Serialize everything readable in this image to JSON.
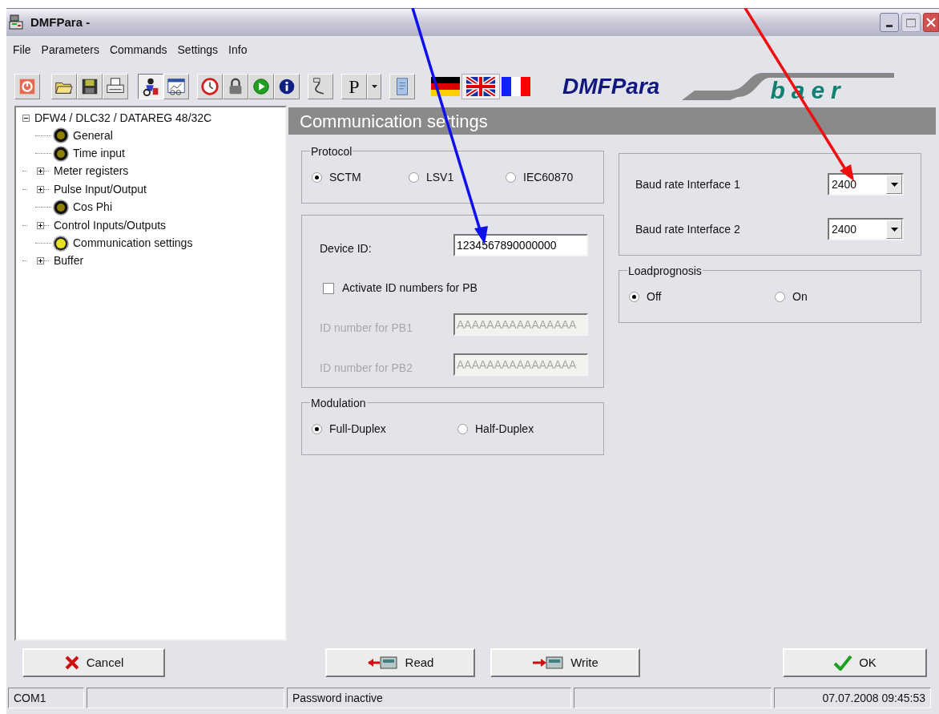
{
  "window": {
    "title": "DMFPara -"
  },
  "menu": [
    "File",
    "Parameters",
    "Commands",
    "Settings",
    "Info"
  ],
  "toolbar": [
    {
      "selected": false
    },
    {
      "selected": false
    },
    {
      "selected": false
    },
    {
      "selected": false
    },
    {
      "selected": true
    },
    {
      "selected": false
    },
    {
      "selected": false
    },
    {
      "selected": false
    },
    {
      "selected": false
    },
    {
      "selected": false
    },
    {
      "selected": false
    },
    {
      "label": "P",
      "selected": false
    },
    {
      "selected": false
    }
  ],
  "languages": [
    {
      "selected": false
    },
    {
      "selected": true
    },
    {
      "selected": false
    }
  ],
  "brand": "DMFPara",
  "logo": "baer",
  "tree": {
    "label": "DFW4 / DLC32 / DATAREG 48/32C",
    "expanded": true,
    "children": [
      {
        "label": "General",
        "kind": "leaf",
        "selected": false
      },
      {
        "label": "Time input",
        "kind": "leaf",
        "selected": false
      },
      {
        "label": "Meter registers",
        "kind": "folder",
        "expanded": false
      },
      {
        "label": "Pulse Input/Output",
        "kind": "folder",
        "expanded": false
      },
      {
        "label": "Cos Phi",
        "kind": "leaf",
        "selected": false
      },
      {
        "label": "Control Inputs/Outputs",
        "kind": "folder",
        "expanded": false
      },
      {
        "label": "Communication settings",
        "kind": "leaf",
        "selected": true
      },
      {
        "label": "Buffer",
        "kind": "folder",
        "expanded": false
      }
    ]
  },
  "heading": "Communication settings",
  "protocol": {
    "title": "Protocol",
    "options": [
      {
        "label": "SCTM",
        "selected": true
      },
      {
        "label": "LSV1",
        "selected": false
      },
      {
        "label": "IEC60870",
        "selected": false
      }
    ]
  },
  "device_id": {
    "label": "Device ID:",
    "value": "1234567890000000"
  },
  "activate_pb": {
    "label": "Activate ID numbers for PB",
    "checked": false
  },
  "pb_fields": [
    {
      "label": "ID number for PB1",
      "value": "AAAAAAAAAAAAAAAA",
      "disabled": true
    },
    {
      "label": "ID number for PB2",
      "value": "AAAAAAAAAAAAAAAA",
      "disabled": true
    }
  ],
  "modulation": {
    "title": "Modulation",
    "options": [
      {
        "label": "Full-Duplex",
        "selected": true
      },
      {
        "label": "Half-Duplex",
        "selected": false
      }
    ]
  },
  "baud_rates": [
    {
      "label": "Baud rate Interface 1",
      "value": "2400"
    },
    {
      "label": "Baud rate Interface 2",
      "value": "2400"
    }
  ],
  "loadprognosis": {
    "title": "Loadprognosis",
    "options": [
      {
        "label": "Off",
        "selected": true
      },
      {
        "label": "On",
        "selected": false
      }
    ]
  },
  "buttons": [
    {
      "label": "Cancel",
      "kind": "cancel"
    },
    {
      "label": "Read",
      "kind": "read"
    },
    {
      "label": "Write",
      "kind": "write"
    },
    {
      "label": "OK",
      "kind": "ok"
    }
  ],
  "status_bar": [
    "COM1",
    "Password inactive",
    "07.07.2008 09:45:53"
  ]
}
